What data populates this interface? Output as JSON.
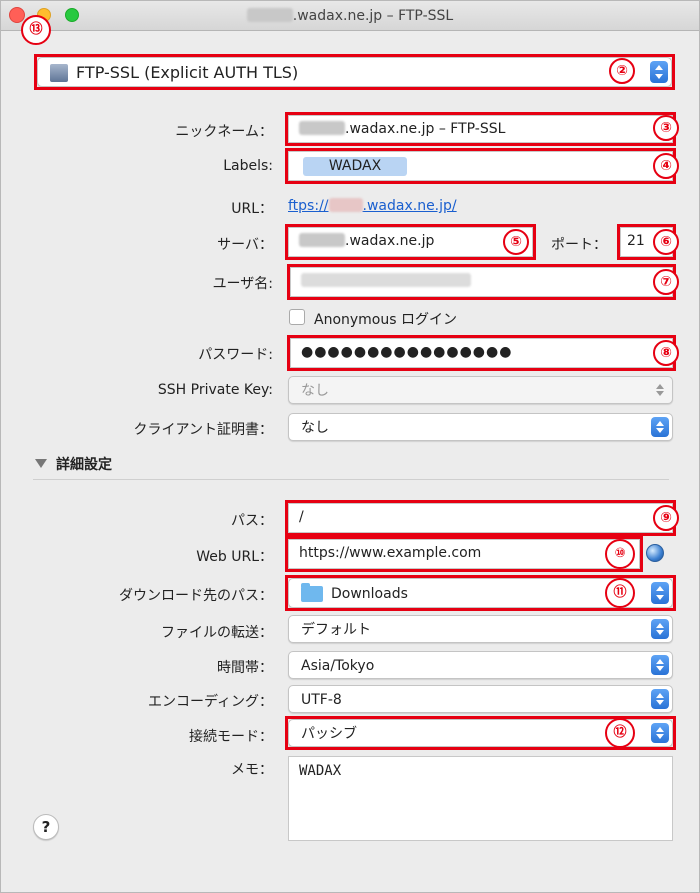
{
  "window": {
    "title_suffix": ".wadax.ne.jp – FTP-SSL"
  },
  "protocol": {
    "value": "FTP-SSL (Explicit AUTH TLS)"
  },
  "form": {
    "nickname": {
      "label": "ニックネーム：",
      "value_suffix": ".wadax.ne.jp – FTP-SSL"
    },
    "labels": {
      "label": "Labels:",
      "tag": "WADAX"
    },
    "url": {
      "label": "URL：",
      "prefix": "ftps://",
      "suffix": ".wadax.ne.jp/"
    },
    "server": {
      "label": "サーバ：",
      "value_suffix": ".wadax.ne.jp"
    },
    "port": {
      "label": "ポート：",
      "value": "21"
    },
    "username": {
      "label": "ユーザ名:"
    },
    "anonymous": {
      "label": "Anonymous ログイン"
    },
    "password": {
      "label": "パスワード:",
      "value": "●●●●●●●●●●●●●●●●"
    },
    "ssh_key": {
      "label": "SSH Private Key:",
      "value": "なし"
    },
    "client_cert": {
      "label": "クライアント証明書：",
      "value": "なし"
    }
  },
  "advanced": {
    "title": "詳細設定",
    "path": {
      "label": "パス：",
      "value": "/"
    },
    "web_url": {
      "label": "Web URL：",
      "value": "https://www.example.com"
    },
    "download_path": {
      "label": "ダウンロード先のパス：",
      "value": "Downloads"
    },
    "transfer": {
      "label": "ファイルの転送：",
      "value": "デフォルト"
    },
    "timezone": {
      "label": "時間帯：",
      "value": "Asia/Tokyo"
    },
    "encoding": {
      "label": "エンコーディング：",
      "value": "UTF-8"
    },
    "connect_mode": {
      "label": "接続モード：",
      "value": "パッシブ"
    },
    "memo": {
      "label": "メモ：",
      "value": "WADAX"
    }
  },
  "help": "?",
  "markers": {
    "n2": "②",
    "n3": "③",
    "n4": "④",
    "n5": "⑤",
    "n6": "⑥",
    "n7": "⑦",
    "n8": "⑧",
    "n9": "⑨",
    "n10": "⑩",
    "n11": "⑪",
    "n12": "⑫",
    "n13": "⑬"
  },
  "colors": {
    "accent": "#2a73d6",
    "marker": "#e60012",
    "link": "#1a5fcf"
  }
}
